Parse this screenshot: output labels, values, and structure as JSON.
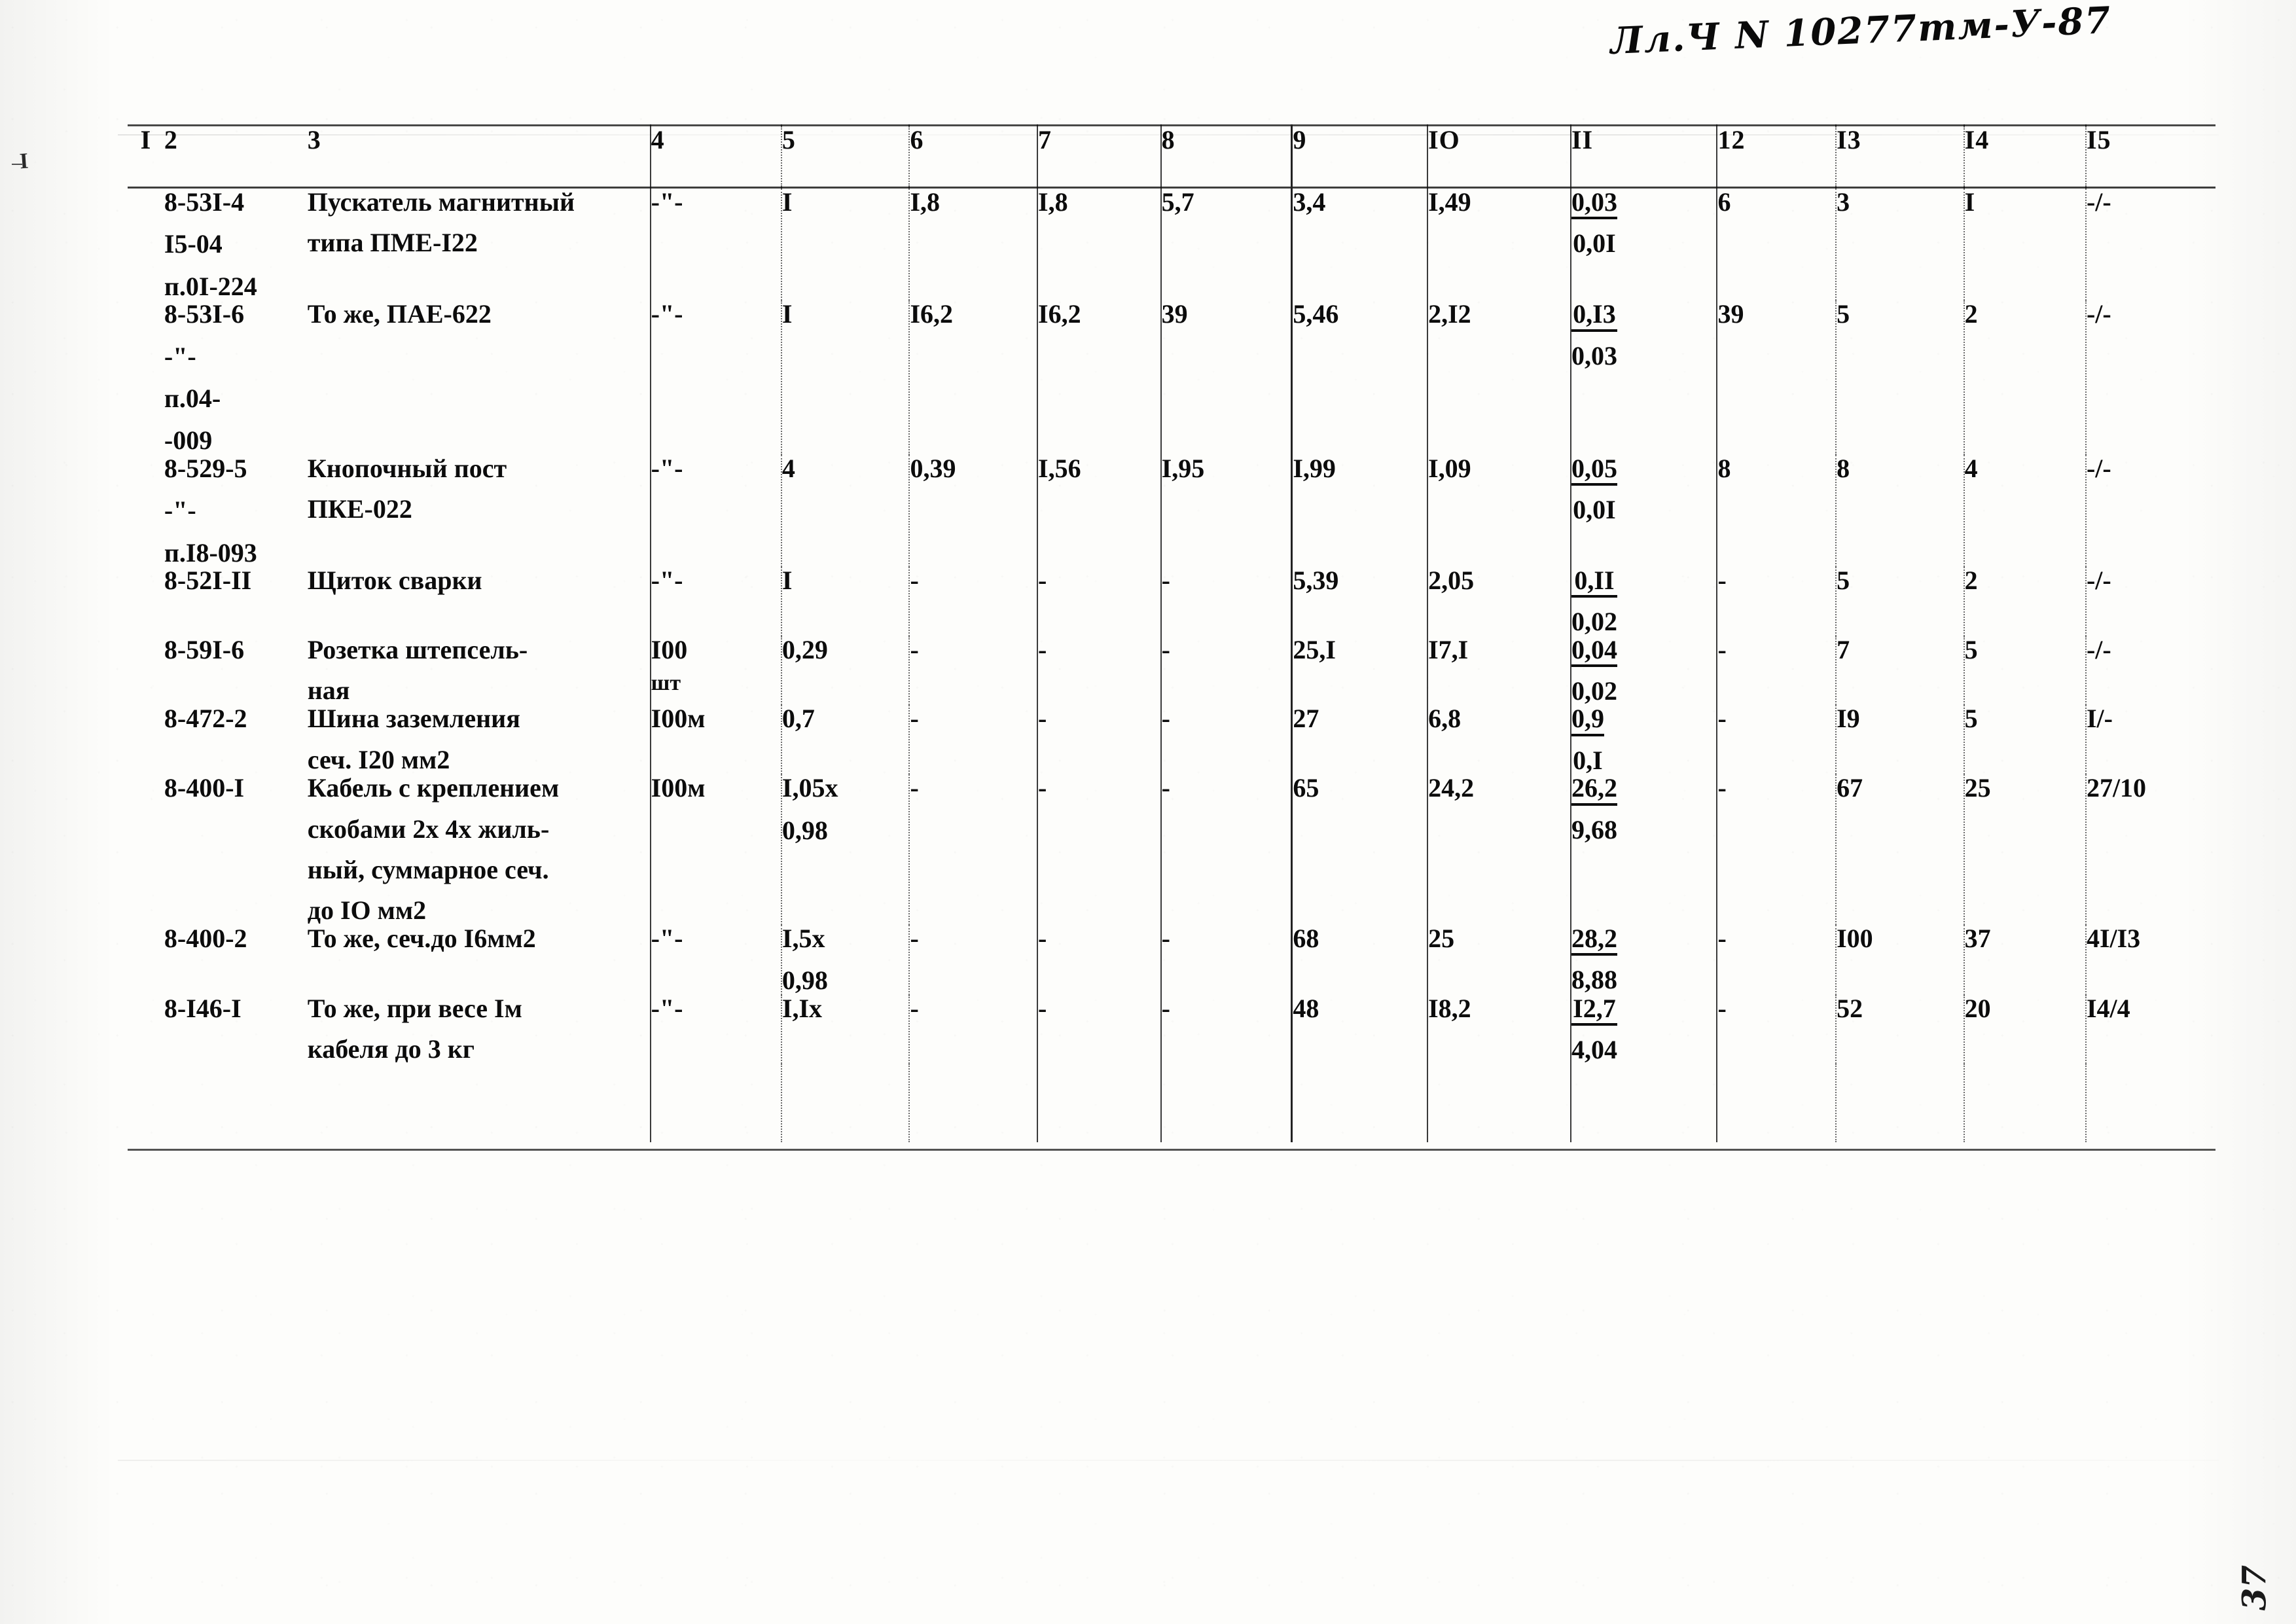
{
  "annotations": {
    "handwritten_header": "Лл.Ч N 10277тм-У-87",
    "margin_mark": "I",
    "page_corner": "37"
  },
  "table": {
    "headers": [
      "I",
      "2",
      "3",
      "4",
      "5",
      "6",
      "7",
      "8",
      "9",
      "IO",
      "II",
      "12",
      "I3",
      "I4",
      "I5"
    ],
    "rows": [
      {
        "code": [
          "8-53I-4",
          "I5-04",
          "п.0I-224"
        ],
        "desc": [
          "Пускатель магнитный",
          "типа ПМЕ-I22"
        ],
        "c4": [
          "-\"-"
        ],
        "c5": [
          "I"
        ],
        "c6": [
          "I,8"
        ],
        "c7": [
          "I,8"
        ],
        "c8": [
          "5,7"
        ],
        "c9": [
          "3,4"
        ],
        "c10": [
          "I,49"
        ],
        "c11_num": "0,03",
        "c11_den": "0,0I",
        "c12": [
          "6"
        ],
        "c13": [
          "3"
        ],
        "c14": [
          "I"
        ],
        "c15": [
          "-/-"
        ]
      },
      {
        "code": [
          "8-53I-6",
          "-\"-",
          "п.04-",
          "-009"
        ],
        "desc": [
          "То же, ПАЕ-622"
        ],
        "c4": [
          "-\"-"
        ],
        "c5": [
          "I"
        ],
        "c6": [
          "I6,2"
        ],
        "c7": [
          "I6,2"
        ],
        "c8": [
          "39"
        ],
        "c9": [
          "5,46"
        ],
        "c10": [
          "2,I2"
        ],
        "c11_num": "0,I3",
        "c11_den": "0,03",
        "c12": [
          "39"
        ],
        "c13": [
          "5"
        ],
        "c14": [
          "2"
        ],
        "c15": [
          "-/-"
        ]
      },
      {
        "code": [
          "8-529-5",
          "-\"-",
          "п.I8-093"
        ],
        "desc": [
          "Кнопочный пост",
          "ПКЕ-022"
        ],
        "c4": [
          "-\"-"
        ],
        "c5": [
          "4"
        ],
        "c6": [
          "0,39"
        ],
        "c7": [
          "I,56"
        ],
        "c8": [
          "I,95"
        ],
        "c9": [
          "I,99"
        ],
        "c10": [
          "I,09"
        ],
        "c11_num": "0,05",
        "c11_den": "0,0I",
        "c12": [
          "8"
        ],
        "c13": [
          "8"
        ],
        "c14": [
          "4"
        ],
        "c15": [
          "-/-"
        ]
      },
      {
        "code": [
          "8-52I-II"
        ],
        "desc": [
          "Щиток сварки"
        ],
        "c4": [
          "-\"-"
        ],
        "c5": [
          "I"
        ],
        "c6": [
          "-"
        ],
        "c7": [
          "-"
        ],
        "c8": [
          "-"
        ],
        "c9": [
          "5,39"
        ],
        "c10": [
          "2,05"
        ],
        "c11_num": "0,II",
        "c11_den": "0,02",
        "c12": [
          "-"
        ],
        "c13": [
          "5"
        ],
        "c14": [
          "2"
        ],
        "c15": [
          "-/-"
        ]
      },
      {
        "code": [
          "8-59I-6"
        ],
        "desc": [
          "Розетка штепсель-",
          "ная"
        ],
        "c4": [
          "I00",
          "шт"
        ],
        "c5": [
          "0,29"
        ],
        "c6": [
          "-"
        ],
        "c7": [
          "-"
        ],
        "c8": [
          "-"
        ],
        "c9": [
          "25,I"
        ],
        "c10": [
          "I7,I"
        ],
        "c11_num": "0,04",
        "c11_den": "0,02",
        "c12": [
          "-"
        ],
        "c13": [
          "7"
        ],
        "c14": [
          "5"
        ],
        "c15": [
          "-/-"
        ]
      },
      {
        "code": [
          "8-472-2"
        ],
        "desc": [
          "Шина заземления",
          "сеч. I20 мм2"
        ],
        "c4": [
          "I00м"
        ],
        "c5": [
          "0,7"
        ],
        "c6": [
          "-"
        ],
        "c7": [
          "-"
        ],
        "c8": [
          "-"
        ],
        "c9": [
          "27"
        ],
        "c10": [
          "6,8"
        ],
        "c11_num": "0,9",
        "c11_den": "0,I",
        "c12": [
          "-"
        ],
        "c13": [
          "I9"
        ],
        "c14": [
          "5"
        ],
        "c15": [
          "I/-"
        ]
      },
      {
        "code": [
          "8-400-I"
        ],
        "desc": [
          "Кабель с креплением",
          "скобами 2х 4х жиль-",
          "ный, суммарное сеч.",
          "до IO мм2"
        ],
        "c4": [
          "I00м"
        ],
        "c5": [
          "I,05х",
          "0,98"
        ],
        "c6": [
          "-"
        ],
        "c7": [
          "-"
        ],
        "c8": [
          "-"
        ],
        "c9": [
          "65"
        ],
        "c10": [
          "24,2"
        ],
        "c11_num": "26,2",
        "c11_den": "9,68",
        "c12": [
          "-"
        ],
        "c13": [
          "67"
        ],
        "c14": [
          "25"
        ],
        "c15": [
          "27/10"
        ]
      },
      {
        "code": [
          "8-400-2"
        ],
        "desc": [
          "То же, сеч.до I6мм2"
        ],
        "c4": [
          "-\"-"
        ],
        "c5": [
          "I,5х",
          "0,98"
        ],
        "c6": [
          "-"
        ],
        "c7": [
          "-"
        ],
        "c8": [
          "-"
        ],
        "c9": [
          "68"
        ],
        "c10": [
          "25"
        ],
        "c11_num": "28,2",
        "c11_den": "8,88",
        "c12": [
          "-"
        ],
        "c13": [
          "I00"
        ],
        "c14": [
          "37"
        ],
        "c15": [
          "4I/I3"
        ]
      },
      {
        "code": [
          "8-I46-I"
        ],
        "desc": [
          "То же, при весе Iм",
          "кабеля до 3 кг"
        ],
        "c4": [
          "-\"-"
        ],
        "c5": [
          "I,Iх"
        ],
        "c6": [
          "-"
        ],
        "c7": [
          "-"
        ],
        "c8": [
          "-"
        ],
        "c9": [
          "48"
        ],
        "c10": [
          "I8,2"
        ],
        "c11_num": "I2,7",
        "c11_den": "4,04",
        "c12": [
          "-"
        ],
        "c13": [
          "52"
        ],
        "c14": [
          "20"
        ],
        "c15": [
          "I4/4"
        ]
      }
    ]
  }
}
